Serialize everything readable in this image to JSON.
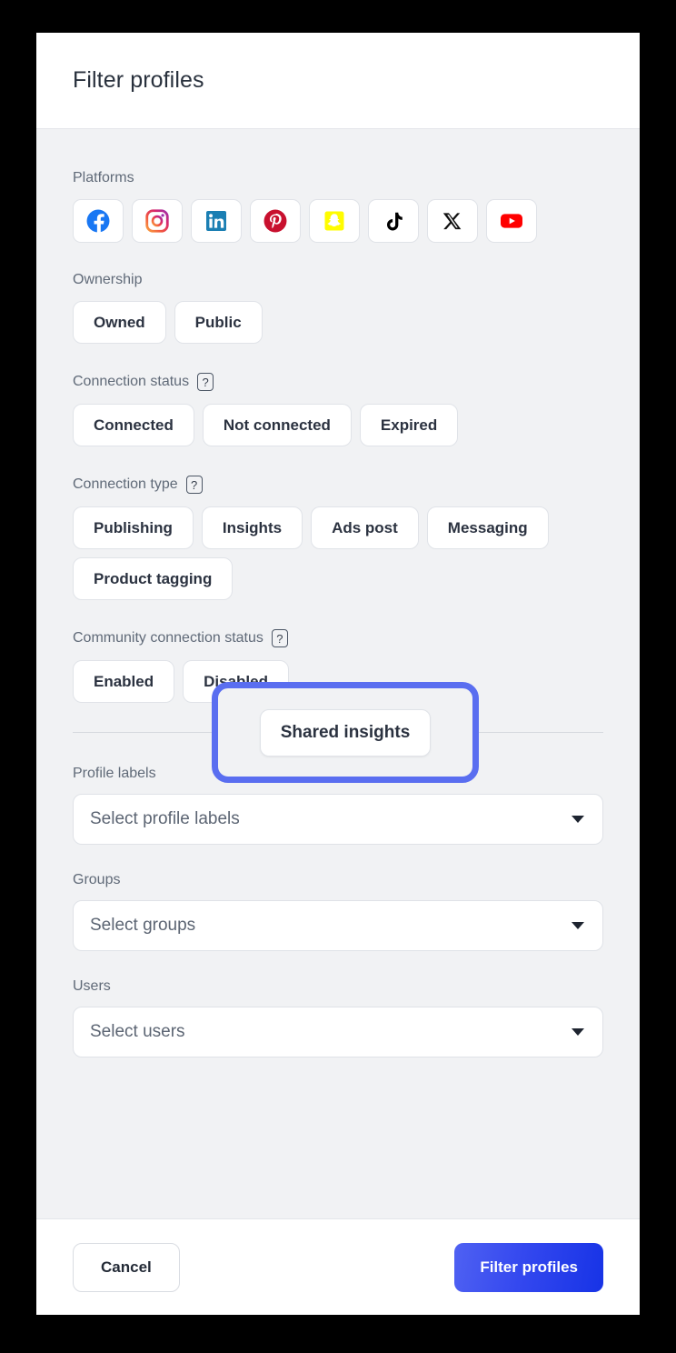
{
  "modal": {
    "title": "Filter profiles"
  },
  "platforms": {
    "label": "Platforms",
    "items": [
      {
        "name": "facebook-icon",
        "label": "Facebook",
        "color": "#1977f3"
      },
      {
        "name": "instagram-icon",
        "label": "Instagram",
        "color": "#e1306c"
      },
      {
        "name": "linkedin-icon",
        "label": "LinkedIn",
        "color": "#1b7fb3"
      },
      {
        "name": "pinterest-icon",
        "label": "Pinterest",
        "color": "#c8102e"
      },
      {
        "name": "snapchat-icon",
        "label": "Snapchat",
        "color": "#fffc00"
      },
      {
        "name": "tiktok-icon",
        "label": "TikTok",
        "color": "#000000"
      },
      {
        "name": "x-icon",
        "label": "X",
        "color": "#000000"
      },
      {
        "name": "youtube-icon",
        "label": "YouTube",
        "color": "#ff0000"
      }
    ]
  },
  "ownership": {
    "label": "Ownership",
    "options": [
      "Owned",
      "Public"
    ]
  },
  "connection_status": {
    "label": "Connection status",
    "help": "?",
    "options": [
      "Connected",
      "Not connected",
      "Expired"
    ]
  },
  "connection_type": {
    "label": "Connection type",
    "help": "?",
    "options": [
      "Publishing",
      "Insights",
      "Ads post",
      "Messaging",
      "Product tagging"
    ]
  },
  "community_connection_status": {
    "label": "Community connection status",
    "help": "?",
    "options": [
      "Enabled",
      "Disabled"
    ]
  },
  "profile_labels": {
    "label": "Profile labels",
    "placeholder": "Select profile labels",
    "value": ""
  },
  "groups": {
    "label": "Groups",
    "placeholder": "Select groups",
    "value": ""
  },
  "users": {
    "label": "Users",
    "placeholder": "Select users",
    "value": ""
  },
  "footer": {
    "cancel_label": "Cancel",
    "submit_label": "Filter profiles"
  },
  "annotation": {
    "highlight_color": "#5a6ef0",
    "chip_label": "Shared insights"
  }
}
